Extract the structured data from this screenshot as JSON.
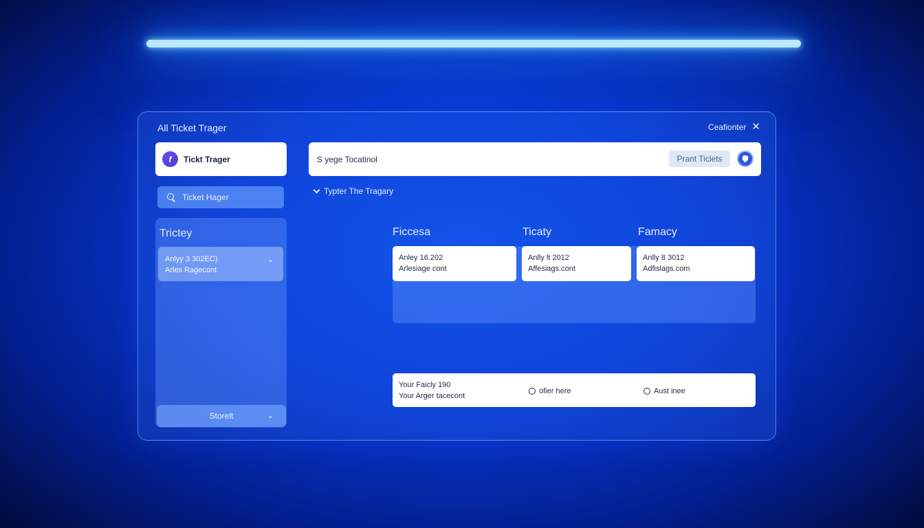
{
  "window": {
    "title": "All Ticket Trager",
    "header_right_label": "Ceafionter"
  },
  "sidebar": {
    "brand_label": "Tickt Trager",
    "brand_glyph": "f",
    "search_placeholder": "Ticket Hager",
    "panel_title": "Trictey",
    "items": [
      {
        "line1": "Anlyy 3 302EC)",
        "line2": "Arles Ragecont"
      }
    ],
    "bottom_label": "Storelt"
  },
  "toolbar": {
    "search_text": "S yege Tocatinol",
    "print_label": "Prant Ticlets"
  },
  "section": {
    "toggle_label": "Typter The Tragary"
  },
  "columns": [
    {
      "title": "Ficcesa",
      "card": {
        "line1": "Anley 16.202",
        "line2": "Arlesiage cont"
      }
    },
    {
      "title": "Ticaty",
      "card": {
        "line1": "Anlly lt 2012",
        "line2": "Affesiags.cont"
      }
    },
    {
      "title": "Famacy",
      "card": {
        "line1": "Anlly 8 3012",
        "line2": "Adfislags.com"
      }
    }
  ],
  "bottom_card": {
    "line1": "Your Faicly 190",
    "line2": "Your Arger tacecont",
    "options": [
      "ofier here",
      "Aust inee"
    ]
  },
  "colors": {
    "accent": "#0638cf",
    "light_bar": "#b9e8ff",
    "card_bg": "#ffffff"
  }
}
